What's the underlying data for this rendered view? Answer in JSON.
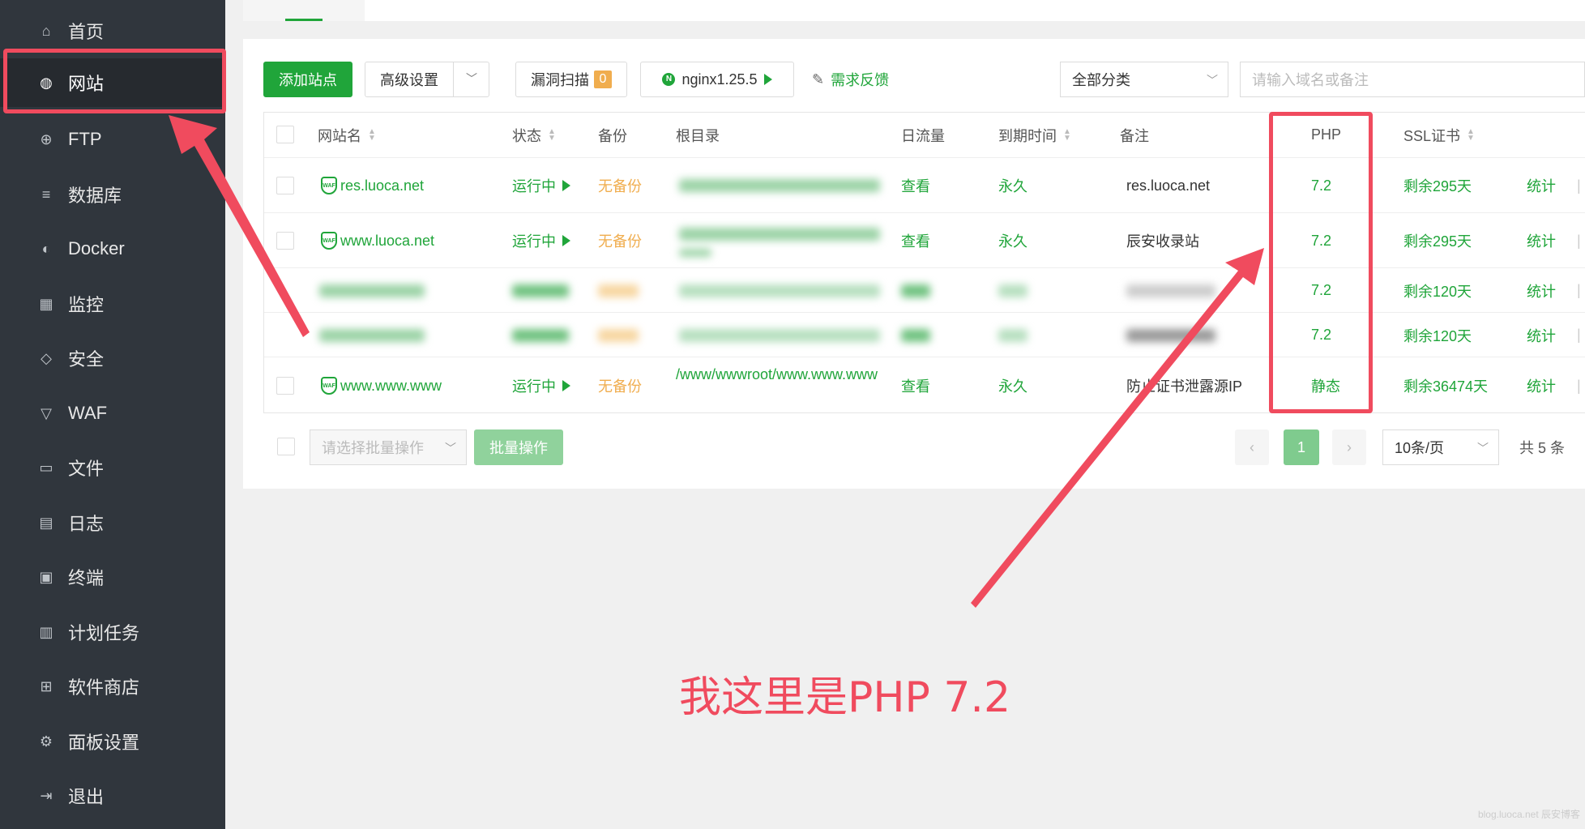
{
  "sidebar": {
    "items": [
      {
        "label": "首页",
        "icon": "home-icon",
        "glyph": "⌂"
      },
      {
        "label": "网站",
        "icon": "globe-icon",
        "glyph": "◍"
      },
      {
        "label": "FTP",
        "icon": "ftp-globe-icon",
        "glyph": "⊕"
      },
      {
        "label": "数据库",
        "icon": "database-icon",
        "glyph": "≡"
      },
      {
        "label": "Docker",
        "icon": "docker-icon",
        "glyph": "◐"
      },
      {
        "label": "监控",
        "icon": "monitor-icon",
        "glyph": "▦"
      },
      {
        "label": "安全",
        "icon": "shield-icon",
        "glyph": "◇"
      },
      {
        "label": "WAF",
        "icon": "waf-icon",
        "glyph": "▽"
      },
      {
        "label": "文件",
        "icon": "folder-icon",
        "glyph": "▭"
      },
      {
        "label": "日志",
        "icon": "log-icon",
        "glyph": "▤"
      },
      {
        "label": "终端",
        "icon": "terminal-icon",
        "glyph": "▣"
      },
      {
        "label": "计划任务",
        "icon": "calendar-icon",
        "glyph": "▥"
      },
      {
        "label": "软件商店",
        "icon": "apps-icon",
        "glyph": "⊞"
      },
      {
        "label": "面板设置",
        "icon": "gear-icon",
        "glyph": "⚙"
      },
      {
        "label": "退出",
        "icon": "logout-icon",
        "glyph": "⇥"
      }
    ],
    "active_index": 1
  },
  "toolbar": {
    "add_site": "添加站点",
    "advanced": "高级设置",
    "scan": "漏洞扫描",
    "scan_count": "0",
    "nginx": "nginx1.25.5",
    "feedback": "需求反馈",
    "category": "全部分类",
    "search_placeholder": "请输入域名或备注"
  },
  "table": {
    "headers": {
      "name": "网站名",
      "status": "状态",
      "backup": "备份",
      "root": "根目录",
      "traffic": "日流量",
      "expire": "到期时间",
      "remark": "备注",
      "php": "PHP",
      "ssl": "SSL证书"
    },
    "rows": [
      {
        "name": "res.luoca.net",
        "status": "运行中",
        "backup": "无备份",
        "root": "",
        "traffic": "查看",
        "expire": "永久",
        "remark": "res.luoca.net",
        "php": "7.2",
        "ssl": "剩余295天",
        "stats": "统计",
        "more": "W"
      },
      {
        "name": "www.luoca.net",
        "status": "运行中",
        "backup": "无备份",
        "root": "",
        "traffic": "查看",
        "expire": "永久",
        "remark": "辰安收录站",
        "php": "7.2",
        "ssl": "剩余295天",
        "stats": "统计",
        "more": "W"
      },
      {
        "name": "",
        "status": "",
        "backup": "",
        "root": "",
        "traffic": "",
        "expire": "",
        "remark": "",
        "php": "7.2",
        "ssl": "剩余120天",
        "stats": "统计",
        "more": "W"
      },
      {
        "name": "",
        "status": "",
        "backup": "",
        "root": "",
        "traffic": "",
        "expire": "",
        "remark": "",
        "php": "7.2",
        "ssl": "剩余120天",
        "stats": "统计",
        "more": "W"
      },
      {
        "name": "www.www.www",
        "status": "运行中",
        "backup": "无备份",
        "root": "/www/wwwroot/www.www.www",
        "traffic": "查看",
        "expire": "永久",
        "remark": "防止证书泄露源IP",
        "php": "静态",
        "ssl": "剩余36474天",
        "stats": "统计",
        "more": "W"
      }
    ]
  },
  "footer": {
    "batch_placeholder": "请选择批量操作",
    "batch_button": "批量操作",
    "prev": "‹",
    "page": "1",
    "next": "›",
    "page_size": "10条/页",
    "total": "共 5 条"
  },
  "annotation": "我这里是PHP 7.2",
  "watermark": "blog.luoca.net 辰安博客",
  "colors": {
    "accent": "#20a53a",
    "warning": "#f0ad4e",
    "annotation": "#f04b5e",
    "sidebar": "#30363d"
  }
}
